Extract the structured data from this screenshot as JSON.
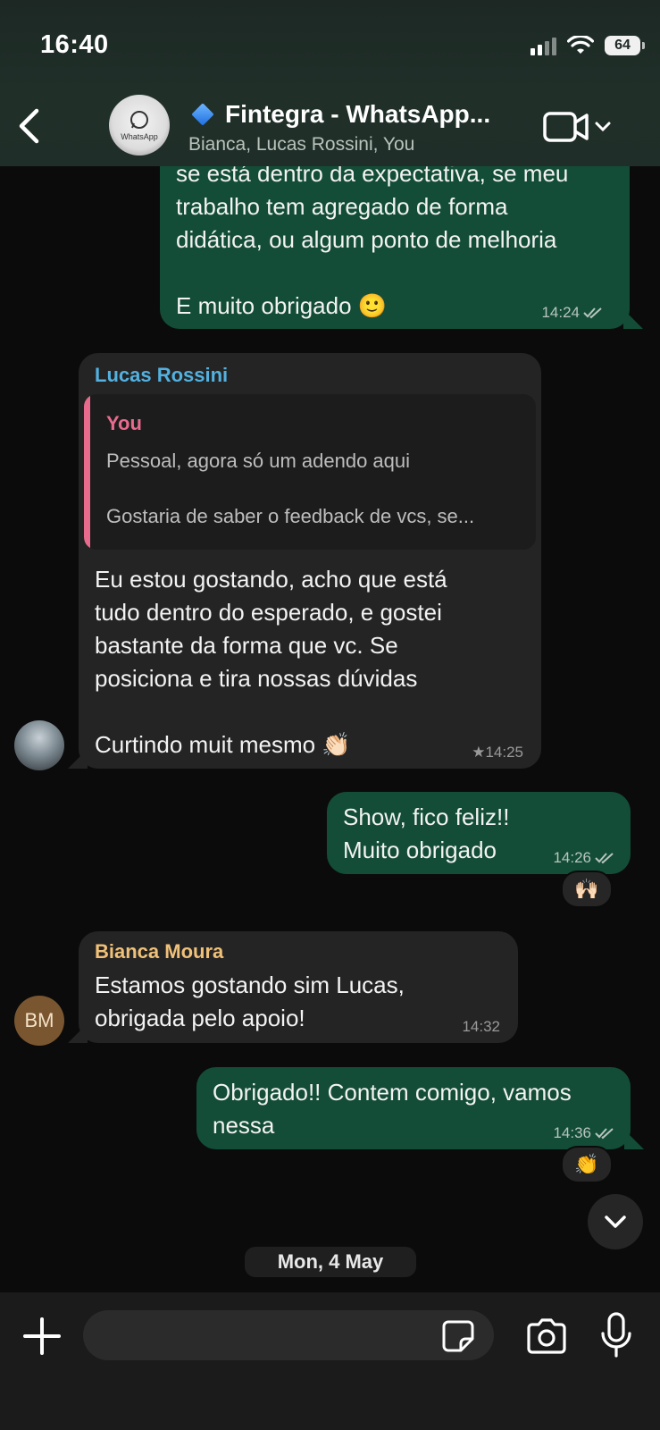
{
  "status_bar": {
    "time": "16:40",
    "battery": "64"
  },
  "header": {
    "avatar_text": "WhatsApp",
    "title": "Fintegra - WhatsApp...",
    "subtitle": "Bianca, Lucas Rossini, You"
  },
  "messages": [
    {
      "type": "outgoing",
      "lines": [
        "se está dentro da expectativa, se meu",
        "trabalho tem agregado de forma",
        "didática, ou algum ponto de melhoria"
      ],
      "line2": "E muito obrigado 🙂",
      "time": "14:24"
    },
    {
      "type": "incoming",
      "sender": "Lucas Rossini",
      "quote": {
        "sender": "You",
        "line1": "Pessoal, agora só um adendo aqui",
        "line2": "Gostaria de saber o feedback de vcs, se..."
      },
      "lines": [
        "Eu estou gostando, acho que está",
        "tudo dentro do esperado, e gostei",
        "bastante da forma que vc. Se",
        "posiciona e tira nossas dúvidas"
      ],
      "line2": "Curtindo muit mesmo 👏🏻",
      "time": "★14:25"
    },
    {
      "type": "outgoing",
      "lines": [
        "Show, fico feliz!!",
        "Muito obrigado"
      ],
      "time": "14:26",
      "reaction": "🙌🏻"
    },
    {
      "type": "incoming",
      "sender": "Bianca Moura",
      "avatar_initials": "BM",
      "lines": [
        "Estamos gostando sim Lucas,",
        "obrigada pelo apoio!"
      ],
      "time": "14:32"
    },
    {
      "type": "outgoing",
      "lines": [
        "Obrigado!! Contem comigo, vamos",
        "nessa"
      ],
      "time": "14:36",
      "reaction": "👏"
    }
  ],
  "date_separator": "Mon, 4 May",
  "composer": {
    "placeholder": ""
  },
  "colors": {
    "outgoing_bubble": "#134d37",
    "incoming_bubble": "#242424",
    "lucas_name": "#53b1e0",
    "bianca_name": "#f0c178",
    "quote_accent": "#e86b8e",
    "header_bg": "#1f2e28"
  },
  "icons": [
    "back-chevron-icon",
    "verified-diamond-icon",
    "video-call-icon",
    "chevron-down-icon",
    "double-check-icon",
    "plus-icon",
    "sticker-icon",
    "camera-icon",
    "microphone-icon"
  ]
}
